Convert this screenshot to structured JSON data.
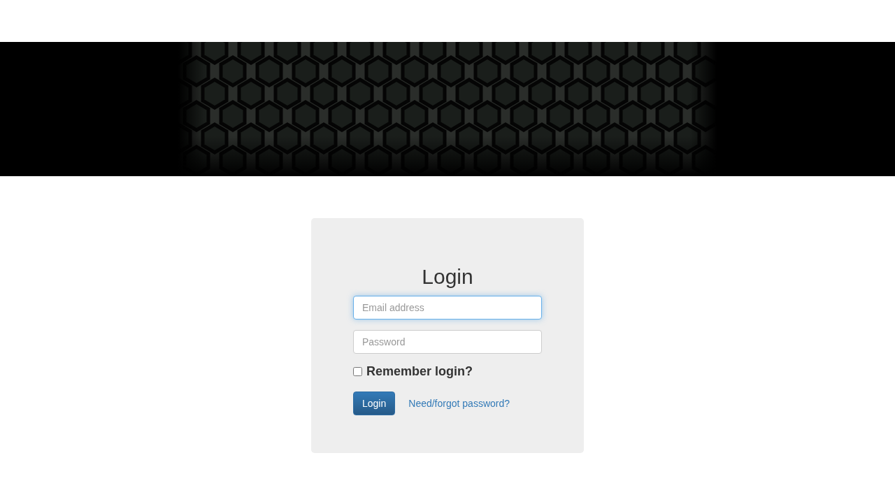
{
  "login_form": {
    "title": "Login",
    "fields": [
      {
        "placeholder": "Email address",
        "focused": true
      },
      {
        "placeholder": "Password",
        "focused": false
      }
    ],
    "remember": {
      "label": "Remember login?",
      "checked": false
    },
    "button": "Login",
    "link": "Need/forgot password?"
  }
}
